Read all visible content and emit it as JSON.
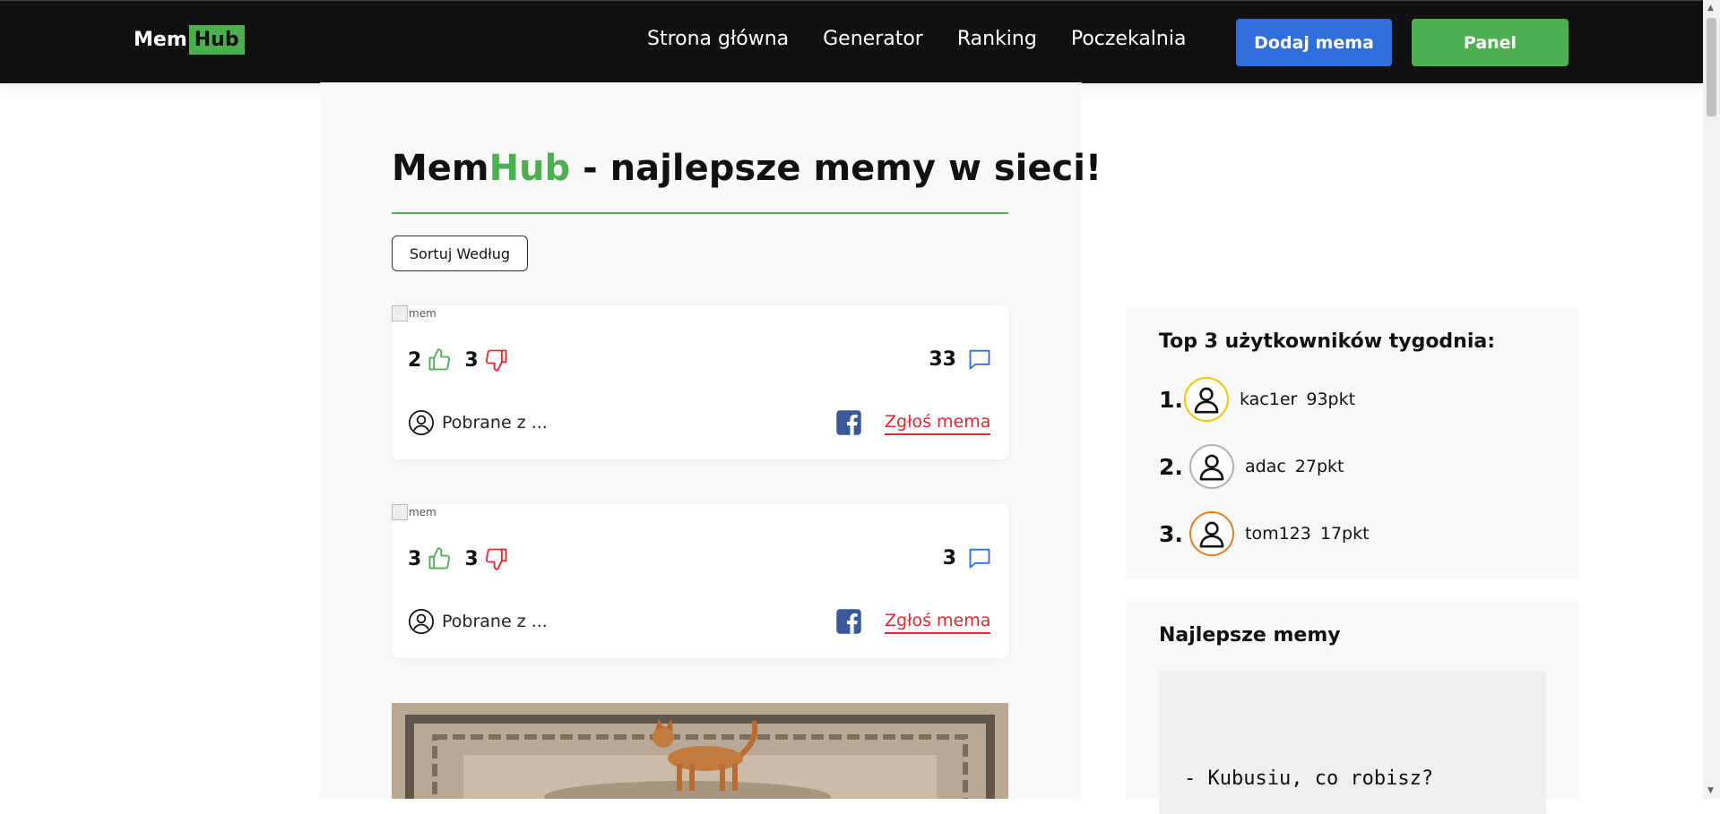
{
  "nav": {
    "logo_mem": "Mem",
    "logo_hub": "Hub",
    "links": [
      "Strona główna",
      "Generator",
      "Ranking",
      "Poczekalnia"
    ],
    "add_button": "Dodaj mema",
    "panel_button": "Panel"
  },
  "page": {
    "title_mem": "Mem",
    "title_hub": "Hub",
    "title_rest": " - najlepsze memy w sieci!",
    "sort_label": "Sortuj Według"
  },
  "cards": [
    {
      "alt": "mem",
      "likes": "2",
      "dislikes": "3",
      "comments": "33",
      "source": "Pobrane z ...",
      "report": "Zgłoś mema"
    },
    {
      "alt": "mem",
      "likes": "3",
      "dislikes": "3",
      "comments": "3",
      "source": "Pobrane z ...",
      "report": "Zgłoś mema"
    }
  ],
  "sidebar": {
    "top_title": "Top 3 użytkowników tygodnia:",
    "top_users": [
      {
        "place": "1.",
        "name": "kac1er",
        "points": "93pkt",
        "ring_color": "#f5c400"
      },
      {
        "place": "2.",
        "name": "adac",
        "points": "27pkt",
        "ring_color": "#b0b0b0"
      },
      {
        "place": "3.",
        "name": "tom123",
        "points": "17pkt",
        "ring_color": "#e67e22"
      }
    ],
    "best_title": "Najlepsze memy",
    "best_meme_text": "- Kubusiu, co robisz?"
  },
  "colors": {
    "accent": "#4caf50",
    "primary": "#2f6fdc",
    "danger": "#e3262f",
    "facebook": "#3b5998"
  }
}
